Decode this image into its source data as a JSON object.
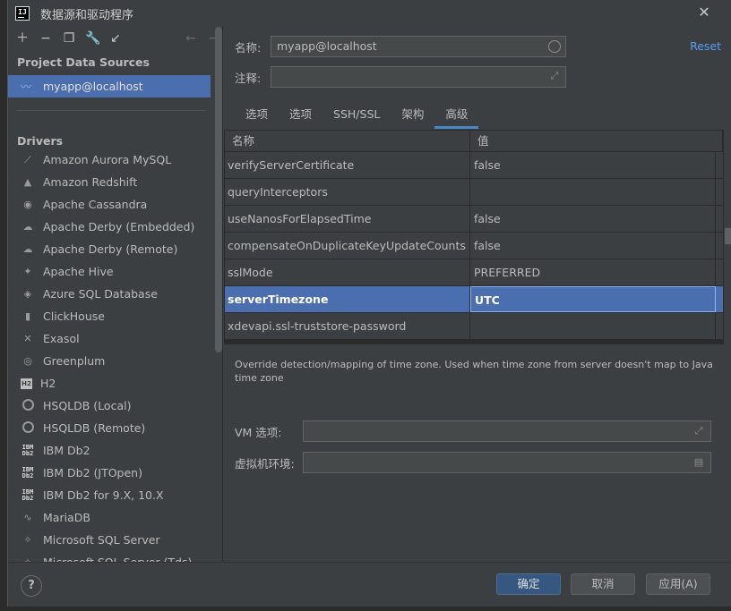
{
  "window": {
    "title": "数据源和驱动程序",
    "logo_text": "IJ"
  },
  "toolbar": {
    "icons": [
      "plus-icon",
      "minus-icon",
      "copy-icon",
      "wrench-icon",
      "import-icon",
      "back-icon",
      "forward-icon"
    ]
  },
  "sidebar": {
    "project_header": "Project Data Sources",
    "data_source": "myapp@localhost",
    "drivers_header": "Drivers",
    "drivers": [
      {
        "label": "Amazon Aurora MySQL",
        "icon": "aurora-icon"
      },
      {
        "label": "Amazon Redshift",
        "icon": "redshift-icon"
      },
      {
        "label": "Apache Cassandra",
        "icon": "cassandra-icon"
      },
      {
        "label": "Apache Derby (Embedded)",
        "icon": "derby-icon"
      },
      {
        "label": "Apache Derby (Remote)",
        "icon": "derby-icon"
      },
      {
        "label": "Apache Hive",
        "icon": "hive-icon"
      },
      {
        "label": "Azure SQL Database",
        "icon": "azure-icon"
      },
      {
        "label": "ClickHouse",
        "icon": "clickhouse-icon"
      },
      {
        "label": "Exasol",
        "icon": "exasol-icon"
      },
      {
        "label": "Greenplum",
        "icon": "greenplum-icon"
      },
      {
        "label": "H2",
        "icon": "h2-icon"
      },
      {
        "label": "HSQLDB (Local)",
        "icon": "hsqldb-icon"
      },
      {
        "label": "HSQLDB (Remote)",
        "icon": "hsqldb-icon"
      },
      {
        "label": "IBM Db2",
        "icon": "ibm-db2-icon"
      },
      {
        "label": "IBM Db2 (JTOpen)",
        "icon": "ibm-db2-icon"
      },
      {
        "label": "IBM Db2 for 9.X, 10.X",
        "icon": "ibm-db2-icon"
      },
      {
        "label": "MariaDB",
        "icon": "mariadb-icon"
      },
      {
        "label": "Microsoft SQL Server",
        "icon": "sqlserver-icon"
      },
      {
        "label": "Microsoft SQL Server (Tds)",
        "icon": "sqlserver-icon"
      }
    ]
  },
  "form": {
    "name_label": "名称:",
    "name_value": "myapp@localhost",
    "comment_label": "注释:",
    "comment_value": "",
    "reset_label": "Reset"
  },
  "tabs": [
    {
      "label": "选项"
    },
    {
      "label": "选项"
    },
    {
      "label": "SSH/SSL"
    },
    {
      "label": "架构"
    },
    {
      "label": "高级"
    }
  ],
  "table": {
    "col_name": "名称",
    "col_value": "值",
    "rows": [
      {
        "name": "verifyServerCertificate",
        "value": "false"
      },
      {
        "name": "queryInterceptors",
        "value": ""
      },
      {
        "name": "useNanosForElapsedTime",
        "value": "false"
      },
      {
        "name": "compensateOnDuplicateKeyUpdateCounts",
        "value": "false"
      },
      {
        "name": "sslMode",
        "value": "PREFERRED"
      },
      {
        "name": "serverTimezone",
        "value": "UTC"
      },
      {
        "name": "xdevapi.ssl-truststore-password",
        "value": ""
      }
    ]
  },
  "description": "Override detection/mapping of time zone. Used when time zone from server doesn't map to Java time zone",
  "vm": {
    "options_label": "VM 选项:",
    "options_value": "",
    "env_label": "虚拟机环境:",
    "env_value": ""
  },
  "footer": {
    "help": "?",
    "ok": "确定",
    "cancel": "取消",
    "apply": "应用(A)"
  },
  "colors": {
    "selection": "#4b6eaf",
    "link": "#589df6",
    "primary_button": "#365880",
    "tab_underline": "#4a88c7"
  }
}
